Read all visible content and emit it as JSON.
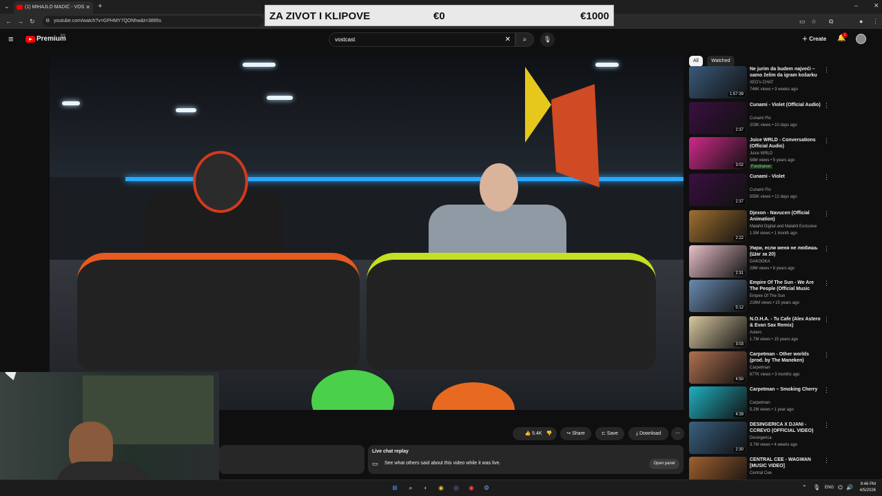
{
  "browser": {
    "tab_title": "(1) MIHAJLO MADIĆ - VOS",
    "url": "youtube.com/watch?v=GPHMY7QONhw&t=3895s",
    "new_tab": "+"
  },
  "overlay": {
    "title": "ZA ZIVOT I KLIPOVE",
    "current": "€0",
    "goal": "€1000"
  },
  "youtube": {
    "brand": "Premium",
    "brand_sup": "RS",
    "search_value": "vostcast",
    "create_label": "Create",
    "notif_count": "1"
  },
  "actions": {
    "likes": "5.4K",
    "share": "Share",
    "save": "Save",
    "download": "Download"
  },
  "chat": {
    "title": "Live chat replay",
    "subtitle": "See what others said about this video while it was live.",
    "open": "Open panel"
  },
  "chips": [
    "All",
    "Watched"
  ],
  "videos": [
    {
      "title": "Ne jurim da budem najveći – samo želim da igram košarku ...",
      "channel": "XEO's CHAT",
      "meta": "746K views • 3 weeks ago",
      "duration": "1:57:39",
      "color": "#3a5a7a"
    },
    {
      "title": "Cunami - Violet (Official Audio)",
      "channel": "Cunami Flo",
      "meta": "203K views • 10 days ago",
      "duration": "2:37",
      "color": "#3a1040"
    },
    {
      "title": "Juice WRLD - Conversations (Official Audio)",
      "channel": "Juice WRLD",
      "meta": "58M views • 5 years ago",
      "extra": "Fundraiser",
      "duration": "3:02",
      "color": "#d02a8a"
    },
    {
      "title": "Cunami - Violet",
      "channel": "Cunami Flo",
      "meta": "555K views • 12 days ago",
      "duration": "2:37",
      "color": "#3a1040"
    },
    {
      "title": "Djexon - Navucen (Official Animation)",
      "channel": "Malahit Digital and Malahit Exclusive",
      "meta": "1.5M views • 1 month ago",
      "duration": "2:22",
      "color": "#a07030"
    },
    {
      "title": "Умри, если меня не любишь (Шаг за 20)",
      "channel": "DAKOOKA",
      "meta": "29M views • 8 years ago",
      "duration": "2:31",
      "color": "#e8c0c8"
    },
    {
      "title": "Empire Of The Sun - We Are The People (Official Music Video)",
      "channel": "Empire Of The Sun",
      "meta": "216M views • 15 years ago",
      "duration": "5:12",
      "color": "#6a8ab0"
    },
    {
      "title": "N.O.H.A. - Tu Cafe (Alex Astero & Evan Sax Remix)",
      "channel": "Astero",
      "meta": "1.7M views • 15 years ago",
      "duration": "3:03",
      "color": "#d8c8a0"
    },
    {
      "title": "Carpetman - Other worlds (prod. by The Maneken)",
      "channel": "Carpetman",
      "meta": "677K views • 3 months ago",
      "duration": "4:50",
      "color": "#b07050"
    },
    {
      "title": "Carpetman – Smoking Cherry",
      "channel": "Carpetman",
      "meta": "5.2M views • 1 year ago",
      "duration": "4:39",
      "color": "#20b0c0"
    },
    {
      "title": "DESINGERICA X DJANI - CCREVO (OFFICIAL VIDEO)",
      "channel": "Desingerica",
      "meta": "3.7M views • 4 weeks ago",
      "duration": "2:30",
      "color": "#3a6080"
    },
    {
      "title": "CENTRAL CEE - WAGWAN [MUSIC VIDEO]",
      "channel": "Central Cee",
      "meta": "",
      "duration": "",
      "color": "#a06030"
    }
  ],
  "taskbar": {
    "lang": "ENG",
    "time": "9:46 PM",
    "date": "4/5/2026"
  }
}
